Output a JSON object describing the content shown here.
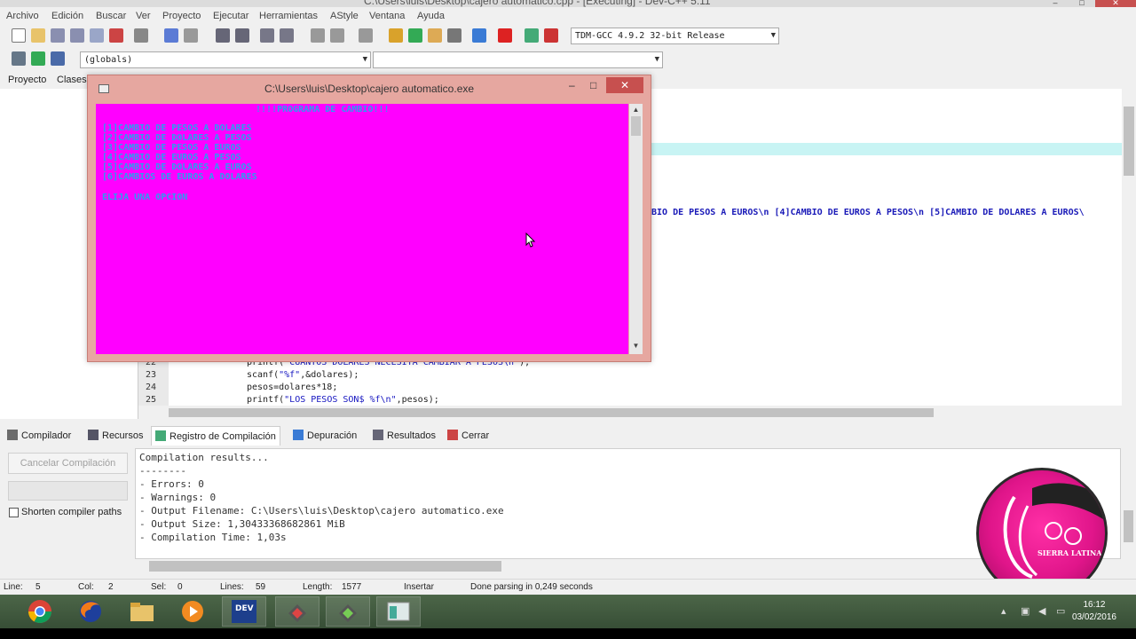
{
  "window": {
    "title": "C:\\Users\\luis\\Desktop\\cajero automatico.cpp - [Executing] - Dev-C++ 5.11"
  },
  "menu": [
    "Archivo",
    "Edición",
    "Buscar",
    "Ver",
    "Proyecto",
    "Ejecutar",
    "Herramientas",
    "AStyle",
    "Ventana",
    "Ayuda"
  ],
  "toolbar": {
    "compiler_select": "TDM-GCC 4.9.2 32-bit Release",
    "scope_select": "(globals)",
    "member_select": ""
  },
  "left_tabs": [
    "Proyecto",
    "Clases"
  ],
  "editor": {
    "lines": [
      {
        "num": "22",
        "code_pre": "printf(",
        "code_str": "\"CUANTOS DOLARES NECESITA CAMBIAR A PESOS\\n\"",
        "code_post": ");"
      },
      {
        "num": "23",
        "code_pre": "scanf(",
        "code_str": "\"%f\"",
        "code_post": ",&dolares);"
      },
      {
        "num": "24",
        "code_pre": "pesos=dolares*18;",
        "code_str": "",
        "code_post": ""
      },
      {
        "num": "25",
        "code_pre": "printf(",
        "code_str": "\"LOS PESOS SON$ %f\\n\"",
        "code_post": ",pesos);"
      }
    ],
    "visible_long_line": "BIO DE PESOS A EUROS\\n [4]CAMBIO DE EUROS A PESOS\\n [5]CAMBIO DE DOLARES A EUROS\\"
  },
  "console": {
    "title": "C:\\Users\\luis\\Desktop\\cajero automatico.exe",
    "header": "!!!!PROGRAMA DE CAMBIO!!!",
    "options": [
      "[1]CAMBIO DE PESOS A DOLARES",
      "[2]CAMBIO DE DOLARES A PESOS",
      "[3]CAMBIO DE PESOS A EUROS",
      "[4]CAMBIO DE EUROS A PESOS",
      "[5]CAMBIO DE DOLARES A EUROS",
      "[6]CAMBIOS DE EUROS A DOLARES"
    ],
    "prompt": "ELIJA UNA OPCION",
    "background_color": "#ff00ff",
    "text_color": "#2a9df0"
  },
  "bottom_tabs": [
    "Compilador",
    "Recursos",
    "Registro de Compilación",
    "Depuración",
    "Resultados",
    "Cerrar"
  ],
  "bottom_panel": {
    "cancel_label": "Cancelar Compilación",
    "shorten_label": "Shorten compiler paths",
    "log": [
      "Compilation results...",
      "--------",
      "- Errors: 0",
      "- Warnings: 0",
      "- Output Filename: C:\\Users\\luis\\Desktop\\cajero automatico.exe",
      "- Output Size: 1,30433368682861 MiB",
      "- Compilation Time: 1,03s"
    ]
  },
  "status": {
    "line_label": "Line:",
    "line_value": "5",
    "col_label": "Col:",
    "col_value": "2",
    "sel_label": "Sel:",
    "sel_value": "0",
    "lines_label": "Lines:",
    "lines_value": "59",
    "length_label": "Length:",
    "length_value": "1577",
    "mode": "Insertar",
    "message": "Done parsing in 0,249 seconds"
  },
  "taskbar": {
    "time": "16:12",
    "date": "03/02/2016",
    "apps": [
      "chrome-icon",
      "firefox-icon",
      "file-explorer-icon",
      "media-player-icon",
      "devcpp-icon",
      "app-icon",
      "app-icon",
      "console-icon"
    ]
  },
  "watermark": {
    "text": "SIERRA LATINA"
  },
  "colors": {
    "close_button": "#c7504f",
    "taskbar": "#3f5a3e",
    "highlight_line": "#c8f4f4"
  }
}
